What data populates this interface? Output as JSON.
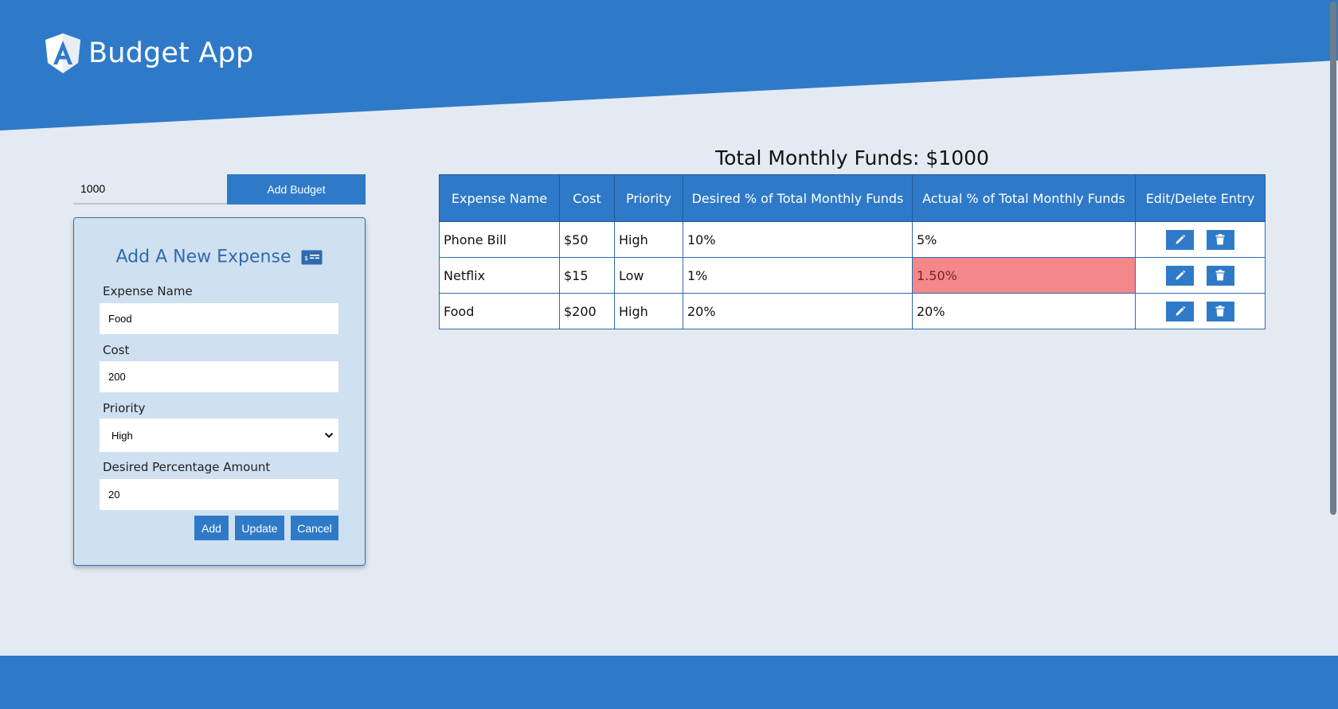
{
  "colors": {
    "primary": "#2f7ac8",
    "page_bg": "#e4eaf2",
    "card_bg": "#cfe0f0",
    "alert_bg": "#f4878a"
  },
  "header": {
    "title": "Budget App",
    "logo_icon": "angular-logo-icon"
  },
  "budget": {
    "value": "1000",
    "button_label": "Add Budget"
  },
  "form": {
    "title": "Add A New Expense",
    "title_icon": "money-check-icon",
    "name_label": "Expense Name",
    "name_value": "Food",
    "cost_label": "Cost",
    "cost_value": "200",
    "priority_label": "Priority",
    "priority_value": "High",
    "percent_label": "Desired Percentage Amount",
    "percent_value": "20",
    "add_label": "Add",
    "update_label": "Update",
    "cancel_label": "Cancel"
  },
  "table": {
    "title": "Total Monthly Funds: $1000",
    "headers": [
      "Expense Name",
      "Cost",
      "Priority",
      "Desired % of Total Monthly Funds",
      "Actual % of Total Monthly Funds",
      "Edit/Delete Entry"
    ],
    "rows": [
      {
        "name": "Phone Bill",
        "cost": "$50",
        "priority": "High",
        "desired": "10%",
        "actual": "5%",
        "over_budget": false
      },
      {
        "name": "Netflix",
        "cost": "$15",
        "priority": "Low",
        "desired": "1%",
        "actual": "1.50%",
        "over_budget": true
      },
      {
        "name": "Food",
        "cost": "$200",
        "priority": "High",
        "desired": "20%",
        "actual": "20%",
        "over_budget": false
      }
    ],
    "edit_icon": "pencil-icon",
    "delete_icon": "trash-icon"
  }
}
